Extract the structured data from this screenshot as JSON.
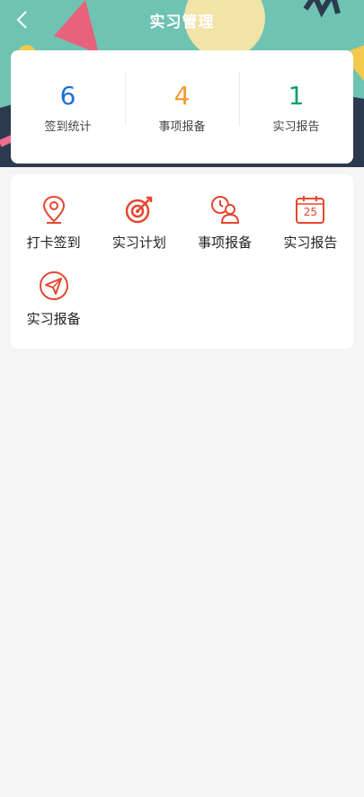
{
  "header": {
    "title": "实习管理",
    "back_icon": "chevron-left-icon"
  },
  "stats": [
    {
      "value": "6",
      "label": "签到统计",
      "color": "#1e6fd9"
    },
    {
      "value": "4",
      "label": "事项报备",
      "color": "#f29b2e"
    },
    {
      "value": "1",
      "label": "实习报告",
      "color": "#0f9d6e"
    }
  ],
  "menu": [
    {
      "label": "打卡签到",
      "icon": "location-pin-icon"
    },
    {
      "label": "实习计划",
      "icon": "target-icon"
    },
    {
      "label": "事项报备",
      "icon": "person-clock-icon"
    },
    {
      "label": "实习报告",
      "icon": "calendar-icon",
      "icon_text": "25"
    },
    {
      "label": "实习报备",
      "icon": "paper-plane-icon"
    }
  ],
  "accent_color": "#e5472f"
}
